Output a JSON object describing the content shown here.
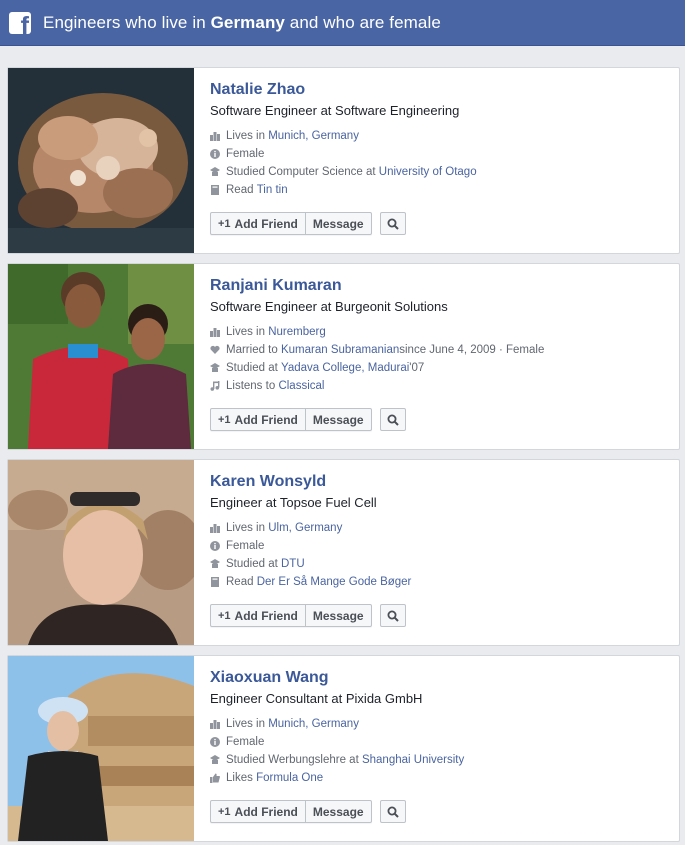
{
  "header": {
    "prefix": "Engineers who live in ",
    "highlight": "Germany",
    "suffix": " and who are female"
  },
  "button_labels": {
    "add_friend": "Add Friend",
    "message": "Message"
  },
  "people": [
    {
      "name": "Natalie Zhao",
      "title": "Software Engineer at Software Engineering",
      "details": [
        {
          "icon": "city-icon",
          "text": "Lives in ",
          "link": "Munich, Germany",
          "after": ""
        },
        {
          "icon": "info-icon",
          "text": "Female",
          "link": "",
          "after": ""
        },
        {
          "icon": "education-icon",
          "text": "Studied Computer Science at ",
          "link": "University of Otago",
          "after": ""
        },
        {
          "icon": "book-icon",
          "text": "Read ",
          "link": "Tin tin",
          "after": ""
        }
      ]
    },
    {
      "name": "Ranjani Kumaran",
      "title": "Software Engineer at Burgeonit Solutions",
      "details": [
        {
          "icon": "city-icon",
          "text": "Lives in ",
          "link": "Nuremberg",
          "after": ""
        },
        {
          "icon": "heart-icon",
          "text": "Married to ",
          "link": "Kumaran Subramanian",
          "after": " since June 4, 2009 · Female"
        },
        {
          "icon": "education-icon",
          "text": "Studied at ",
          "link": "Yadava College, Madurai",
          "after": " '07"
        },
        {
          "icon": "music-icon",
          "text": "Listens to ",
          "link": "Classical",
          "after": ""
        }
      ]
    },
    {
      "name": "Karen Wonsyld",
      "title": "Engineer at Topsoe Fuel Cell",
      "details": [
        {
          "icon": "city-icon",
          "text": "Lives in ",
          "link": "Ulm, Germany",
          "after": ""
        },
        {
          "icon": "info-icon",
          "text": "Female",
          "link": "",
          "after": ""
        },
        {
          "icon": "education-icon",
          "text": "Studied at ",
          "link": "DTU",
          "after": ""
        },
        {
          "icon": "book-icon",
          "text": "Read ",
          "link": "Der Er Så Mange Gode Bøger",
          "after": ""
        }
      ]
    },
    {
      "name": "Xiaoxuan Wang",
      "title": "Engineer Consultant at Pixida GmbH",
      "details": [
        {
          "icon": "city-icon",
          "text": "Lives in ",
          "link": "Munich, Germany",
          "after": ""
        },
        {
          "icon": "info-icon",
          "text": "Female",
          "link": "",
          "after": ""
        },
        {
          "icon": "education-icon",
          "text": "Studied Werbungslehre at ",
          "link": "Shanghai University",
          "after": ""
        },
        {
          "icon": "thumbs-up-icon",
          "text": "Likes ",
          "link": "Formula One",
          "after": ""
        }
      ]
    }
  ]
}
